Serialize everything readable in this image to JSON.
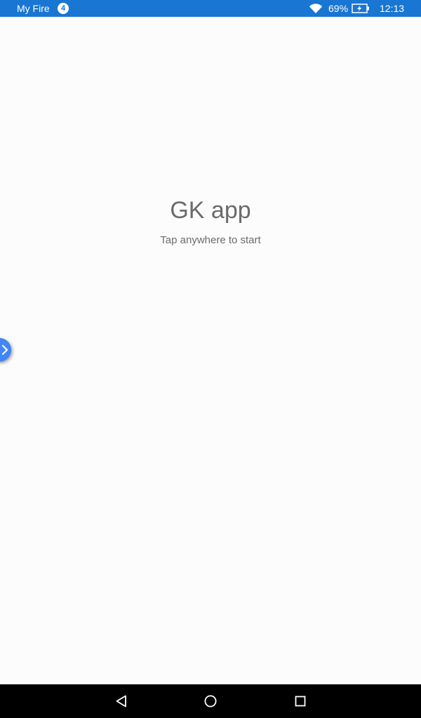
{
  "status_bar": {
    "carrier": "My Fire",
    "notification_count": "4",
    "battery_percent": "69%",
    "time": "12:13",
    "background_color": "#1976d2",
    "icons": [
      "wifi-icon",
      "battery-charging-icon"
    ]
  },
  "app": {
    "title": "GK app",
    "subtitle": "Tap anywhere to start",
    "text_color": "#6b6b6b"
  },
  "edge_handle": {
    "icon": "chevron-right-icon",
    "color": "#4285f4"
  },
  "nav_bar": {
    "icons": [
      "back-icon",
      "home-icon",
      "recents-icon"
    ]
  }
}
